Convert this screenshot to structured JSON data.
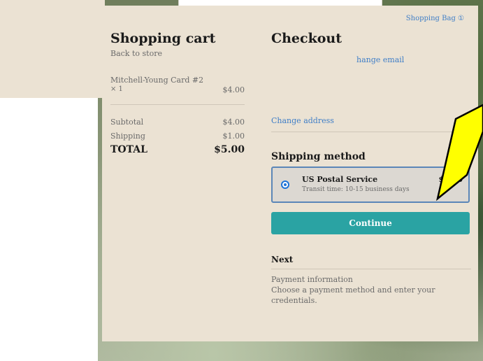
{
  "cart": {
    "title": "Shopping cart",
    "back_link": "Back to store",
    "item": {
      "name": "Mitchell-Young Card #2",
      "qty": "× 1",
      "price": "$4.00"
    },
    "subtotal_label": "Subtotal",
    "subtotal_value": "$4.00",
    "shipping_label": "Shipping",
    "shipping_value": "$1.00",
    "total_label": "TOTAL",
    "total_value": "$5.00"
  },
  "header": {
    "bag_link": "Shopping Bag ①"
  },
  "checkout": {
    "title": "Checkout",
    "change_email": "hange email",
    "change_address": "Change address",
    "shipping_heading": "Shipping method",
    "option": {
      "name": "US Postal Service",
      "transit": "Transit time: 10-15 business days",
      "price": "$1.00"
    },
    "continue_label": "Continue",
    "next_heading": "Next",
    "next_title": "Payment information",
    "next_desc": "Choose a payment method and enter your credentials."
  },
  "colors": {
    "panel_bg": "#ebe2d3",
    "link": "#3f7ec7",
    "continue_button": "#2aa3a3",
    "callout": "#ffff00"
  }
}
